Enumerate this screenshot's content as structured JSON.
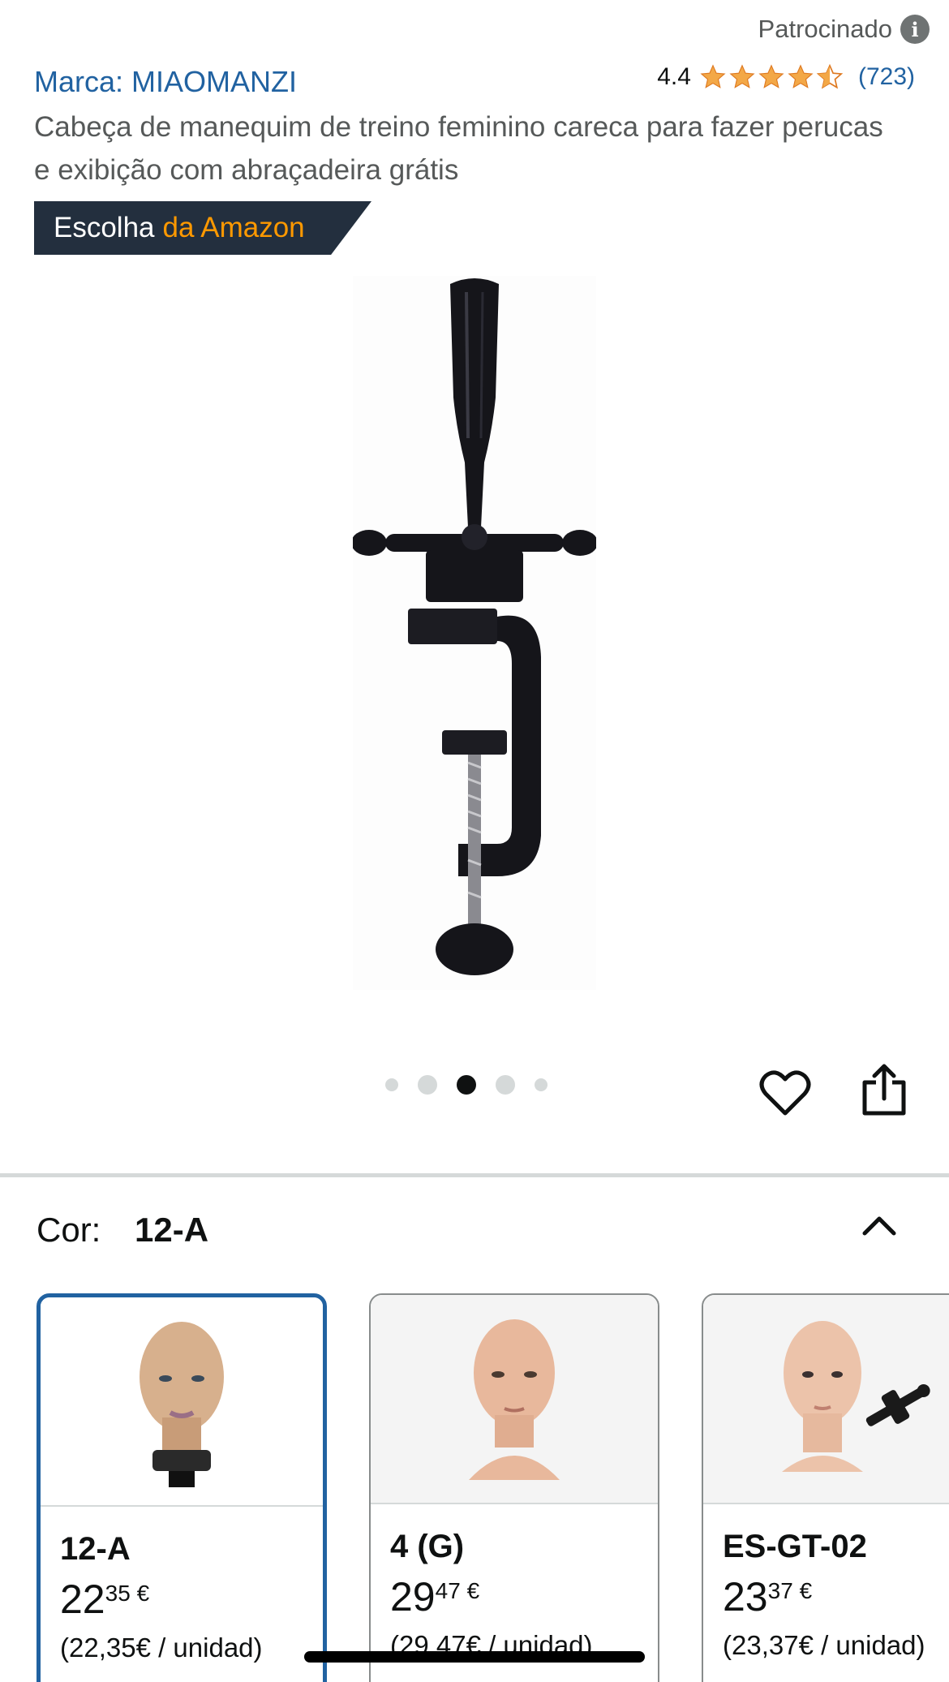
{
  "sponsored": {
    "label": "Patrocinado",
    "icon": "info-icon"
  },
  "brand": {
    "label": "Marca: MIAOMANZI"
  },
  "rating": {
    "value": "4.4",
    "stars": 4.4,
    "count": "(723)",
    "star_color": "#f3a847"
  },
  "product": {
    "title": "Cabeça de manequim de treino feminino careca para fazer perucas e exibição com abraçadeira grátis",
    "image_icon": "wig-clamp-stand-image"
  },
  "badge": {
    "prefix": "Escolha",
    "accent": "da Amazon",
    "accent_color": "#ff9900",
    "bg_color": "#232f3e"
  },
  "carousel": {
    "dot_count": 5,
    "active_index": 2
  },
  "actions": {
    "wishlist_icon": "heart-icon",
    "share_icon": "share-icon"
  },
  "variation": {
    "label": "Cor:",
    "selected": "12-A",
    "toggle_icon": "chevron-up-icon"
  },
  "variants": [
    {
      "name": "12-A",
      "price_whole": "22",
      "price_fraction": "35",
      "currency": "€",
      "unit_price": "(22,35€ / unidad)",
      "selected": true
    },
    {
      "name": "4 (G)",
      "price_whole": "29",
      "price_fraction": "47",
      "currency": "€",
      "unit_price": "(29,47€ / unidad)",
      "selected": false
    },
    {
      "name": "ES-GT-02",
      "price_whole": "23",
      "price_fraction": "37",
      "currency": "€",
      "unit_price": "(23,37€ / unidad)",
      "selected": false
    }
  ]
}
